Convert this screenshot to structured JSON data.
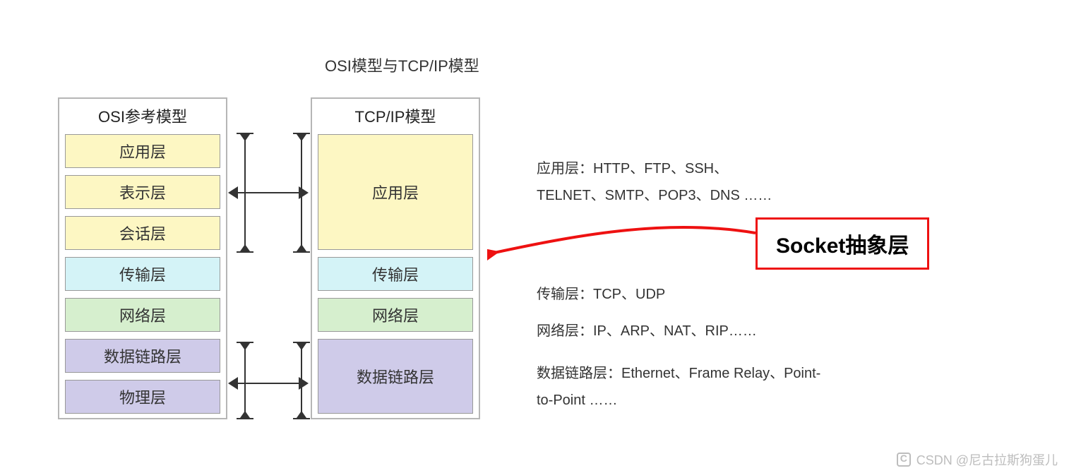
{
  "title": "OSI模型与TCP/IP模型",
  "osi": {
    "header": "OSI参考模型",
    "layers": [
      "应用层",
      "表示层",
      "会话层",
      "传输层",
      "网络层",
      "数据链路层",
      "物理层"
    ]
  },
  "tcpip": {
    "header": "TCP/IP模型",
    "layers": [
      "应用层",
      "传输层",
      "网络层",
      "数据链路层"
    ]
  },
  "descriptions": {
    "application": "应用层：HTTP、FTP、SSH、TELNET、SMTP、POP3、DNS ……",
    "transport": "传输层：TCP、UDP",
    "network": "网络层：IP、ARP、NAT、RIP……",
    "datalink": "数据链路层：Ethernet、Frame Relay、Point-to-Point ……"
  },
  "callout": "Socket抽象层",
  "watermark": "CSDN @尼古拉斯狗蛋儿",
  "colors": {
    "yellow": "#fdf7c3",
    "cyan": "#d4f3f7",
    "green": "#d6efce",
    "purple": "#cfcbe9",
    "red": "#e11"
  }
}
